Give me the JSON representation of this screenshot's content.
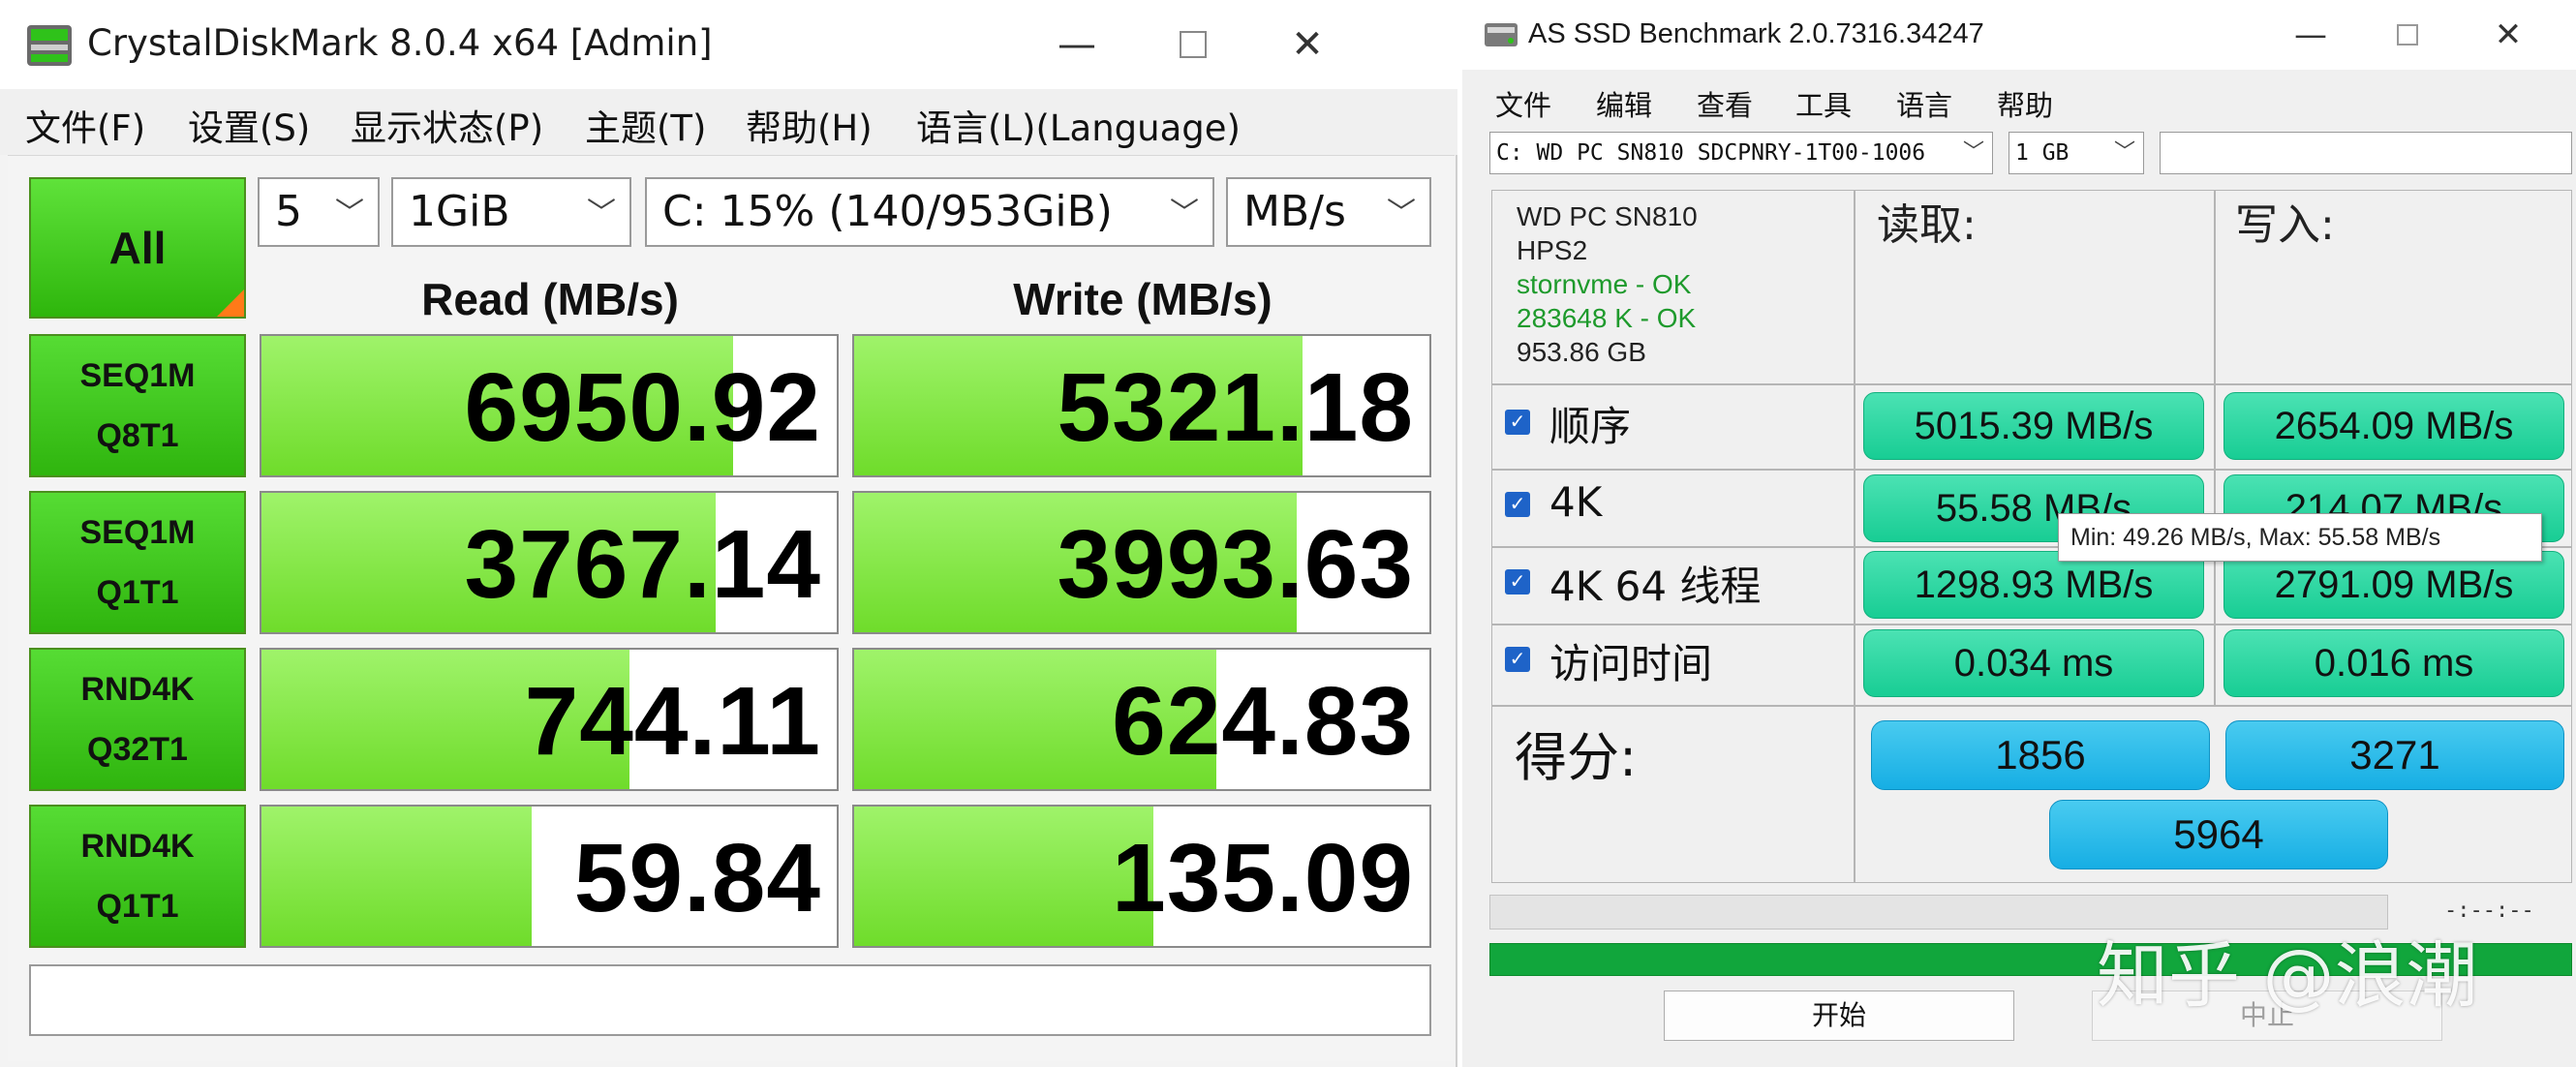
{
  "cdm": {
    "title": "CrystalDiskMark 8.0.4 x64 [Admin]",
    "menu": [
      "文件(F)",
      "设置(S)",
      "显示状态(P)",
      "主题(T)",
      "帮助(H)",
      "语言(L)(Language)"
    ],
    "all_label": "All",
    "count": "5",
    "size": "1GiB",
    "drive": "C: 15% (140/953GiB)",
    "unit": "MB/s",
    "read_header": "Read (MB/s)",
    "write_header": "Write (MB/s)",
    "tests": [
      {
        "line1": "SEQ1M",
        "line2": "Q8T1",
        "read": "6950.92",
        "write": "5321.18"
      },
      {
        "line1": "SEQ1M",
        "line2": "Q1T1",
        "read": "3767.14",
        "write": "3993.63"
      },
      {
        "line1": "RND4K",
        "line2": "Q32T1",
        "read": "744.11",
        "write": "624.83"
      },
      {
        "line1": "RND4K",
        "line2": "Q1T1",
        "read": "59.84",
        "write": "135.09"
      }
    ],
    "bar_fill": {
      "read": [
        0.82,
        0.79,
        0.64,
        0.47
      ],
      "write": [
        0.78,
        0.77,
        0.63,
        0.52
      ]
    },
    "colors": {
      "accent": "#2eb60c",
      "bar": "#8be84f",
      "corner": "#ff7a18"
    }
  },
  "asssd": {
    "title": "AS SSD Benchmark 2.0.7316.34247",
    "menu": [
      "文件",
      "编辑",
      "查看",
      "工具",
      "语言",
      "帮助"
    ],
    "drive_select": "C: WD PC SN810 SDCPNRY-1T00-1006",
    "size_select": "1 GB",
    "drive_info": {
      "model": "WD PC SN810",
      "firmware": "HPS2",
      "driver": "stornvme - OK",
      "alignment": "283648 K - OK",
      "capacity": "953.86 GB"
    },
    "read_header": "读取:",
    "write_header": "写入:",
    "rows": [
      {
        "label": "顺序",
        "read": "5015.39 MB/s",
        "write": "2654.09 MB/s"
      },
      {
        "label": "4K",
        "read": "55.58 MB/s",
        "write": "214.07 MB/s"
      },
      {
        "label": "4K 64 线程",
        "read": "1298.93 MB/s",
        "write": "2791.09 MB/s"
      },
      {
        "label": "访问时间",
        "read": "0.034 ms",
        "write": "0.016 ms"
      }
    ],
    "score_label": "得分:",
    "score_read": "1856",
    "score_write": "3271",
    "score_total": "5964",
    "tooltip": "Min: 49.26 MB/s, Max: 55.58 MB/s",
    "time_readout": "-:--:--",
    "progress": 1.0,
    "start_label": "开始",
    "stop_label": "中止",
    "watermark": "知乎 @浪潮",
    "colors": {
      "value": "#1fd39c",
      "score": "#1bb3e8",
      "progress": "#11a63c",
      "check": "#1e63c8"
    }
  }
}
